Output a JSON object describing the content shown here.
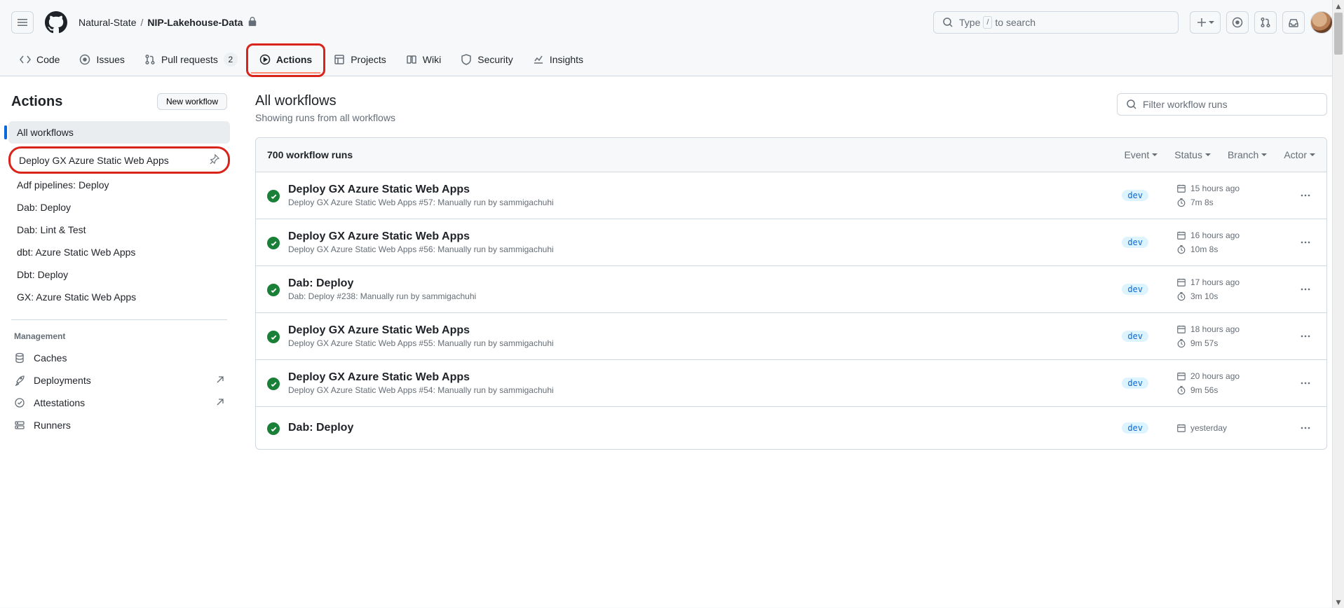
{
  "header": {
    "org": "Natural-State",
    "repo": "NIP-Lakehouse-Data",
    "search_prefix": "Type ",
    "search_key": "/",
    "search_suffix": " to search"
  },
  "repo_nav": {
    "code": "Code",
    "issues": "Issues",
    "pull_requests": "Pull requests",
    "pr_count": "2",
    "actions": "Actions",
    "projects": "Projects",
    "wiki": "Wiki",
    "security": "Security",
    "insights": "Insights"
  },
  "sidebar": {
    "title": "Actions",
    "new_workflow": "New workflow",
    "all": "All workflows",
    "workflows": [
      "Deploy GX Azure Static Web Apps",
      "Adf pipelines: Deploy",
      "Dab: Deploy",
      "Dab: Lint & Test",
      "dbt: Azure Static Web Apps",
      "Dbt: Deploy",
      "GX: Azure Static Web Apps"
    ],
    "management_label": "Management",
    "management": {
      "caches": "Caches",
      "deployments": "Deployments",
      "attestations": "Attestations",
      "runners": "Runners"
    }
  },
  "content": {
    "title": "All workflows",
    "subtitle": "Showing runs from all workflows",
    "filter_placeholder": "Filter workflow runs",
    "runs_count": "700 workflow runs",
    "filters": {
      "event": "Event",
      "status": "Status",
      "branch": "Branch",
      "actor": "Actor"
    },
    "runs": [
      {
        "title": "Deploy GX Azure Static Web Apps",
        "wf": "Deploy GX Azure Static Web Apps",
        "num": "#57",
        "desc": ": Manually run by sammigachuhi",
        "branch": "dev",
        "time": "15 hours ago",
        "dur": "7m 8s"
      },
      {
        "title": "Deploy GX Azure Static Web Apps",
        "wf": "Deploy GX Azure Static Web Apps",
        "num": "#56",
        "desc": ": Manually run by sammigachuhi",
        "branch": "dev",
        "time": "16 hours ago",
        "dur": "10m 8s"
      },
      {
        "title": "Dab: Deploy",
        "wf": "Dab: Deploy",
        "num": "#238",
        "desc": ": Manually run by sammigachuhi",
        "branch": "dev",
        "time": "17 hours ago",
        "dur": "3m 10s"
      },
      {
        "title": "Deploy GX Azure Static Web Apps",
        "wf": "Deploy GX Azure Static Web Apps",
        "num": "#55",
        "desc": ": Manually run by sammigachuhi",
        "branch": "dev",
        "time": "18 hours ago",
        "dur": "9m 57s"
      },
      {
        "title": "Deploy GX Azure Static Web Apps",
        "wf": "Deploy GX Azure Static Web Apps",
        "num": "#54",
        "desc": ": Manually run by sammigachuhi",
        "branch": "dev",
        "time": "20 hours ago",
        "dur": "9m 56s"
      },
      {
        "title": "Dab: Deploy",
        "wf": "",
        "num": "",
        "desc": "",
        "branch": "dev",
        "time": "yesterday",
        "dur": ""
      }
    ]
  }
}
